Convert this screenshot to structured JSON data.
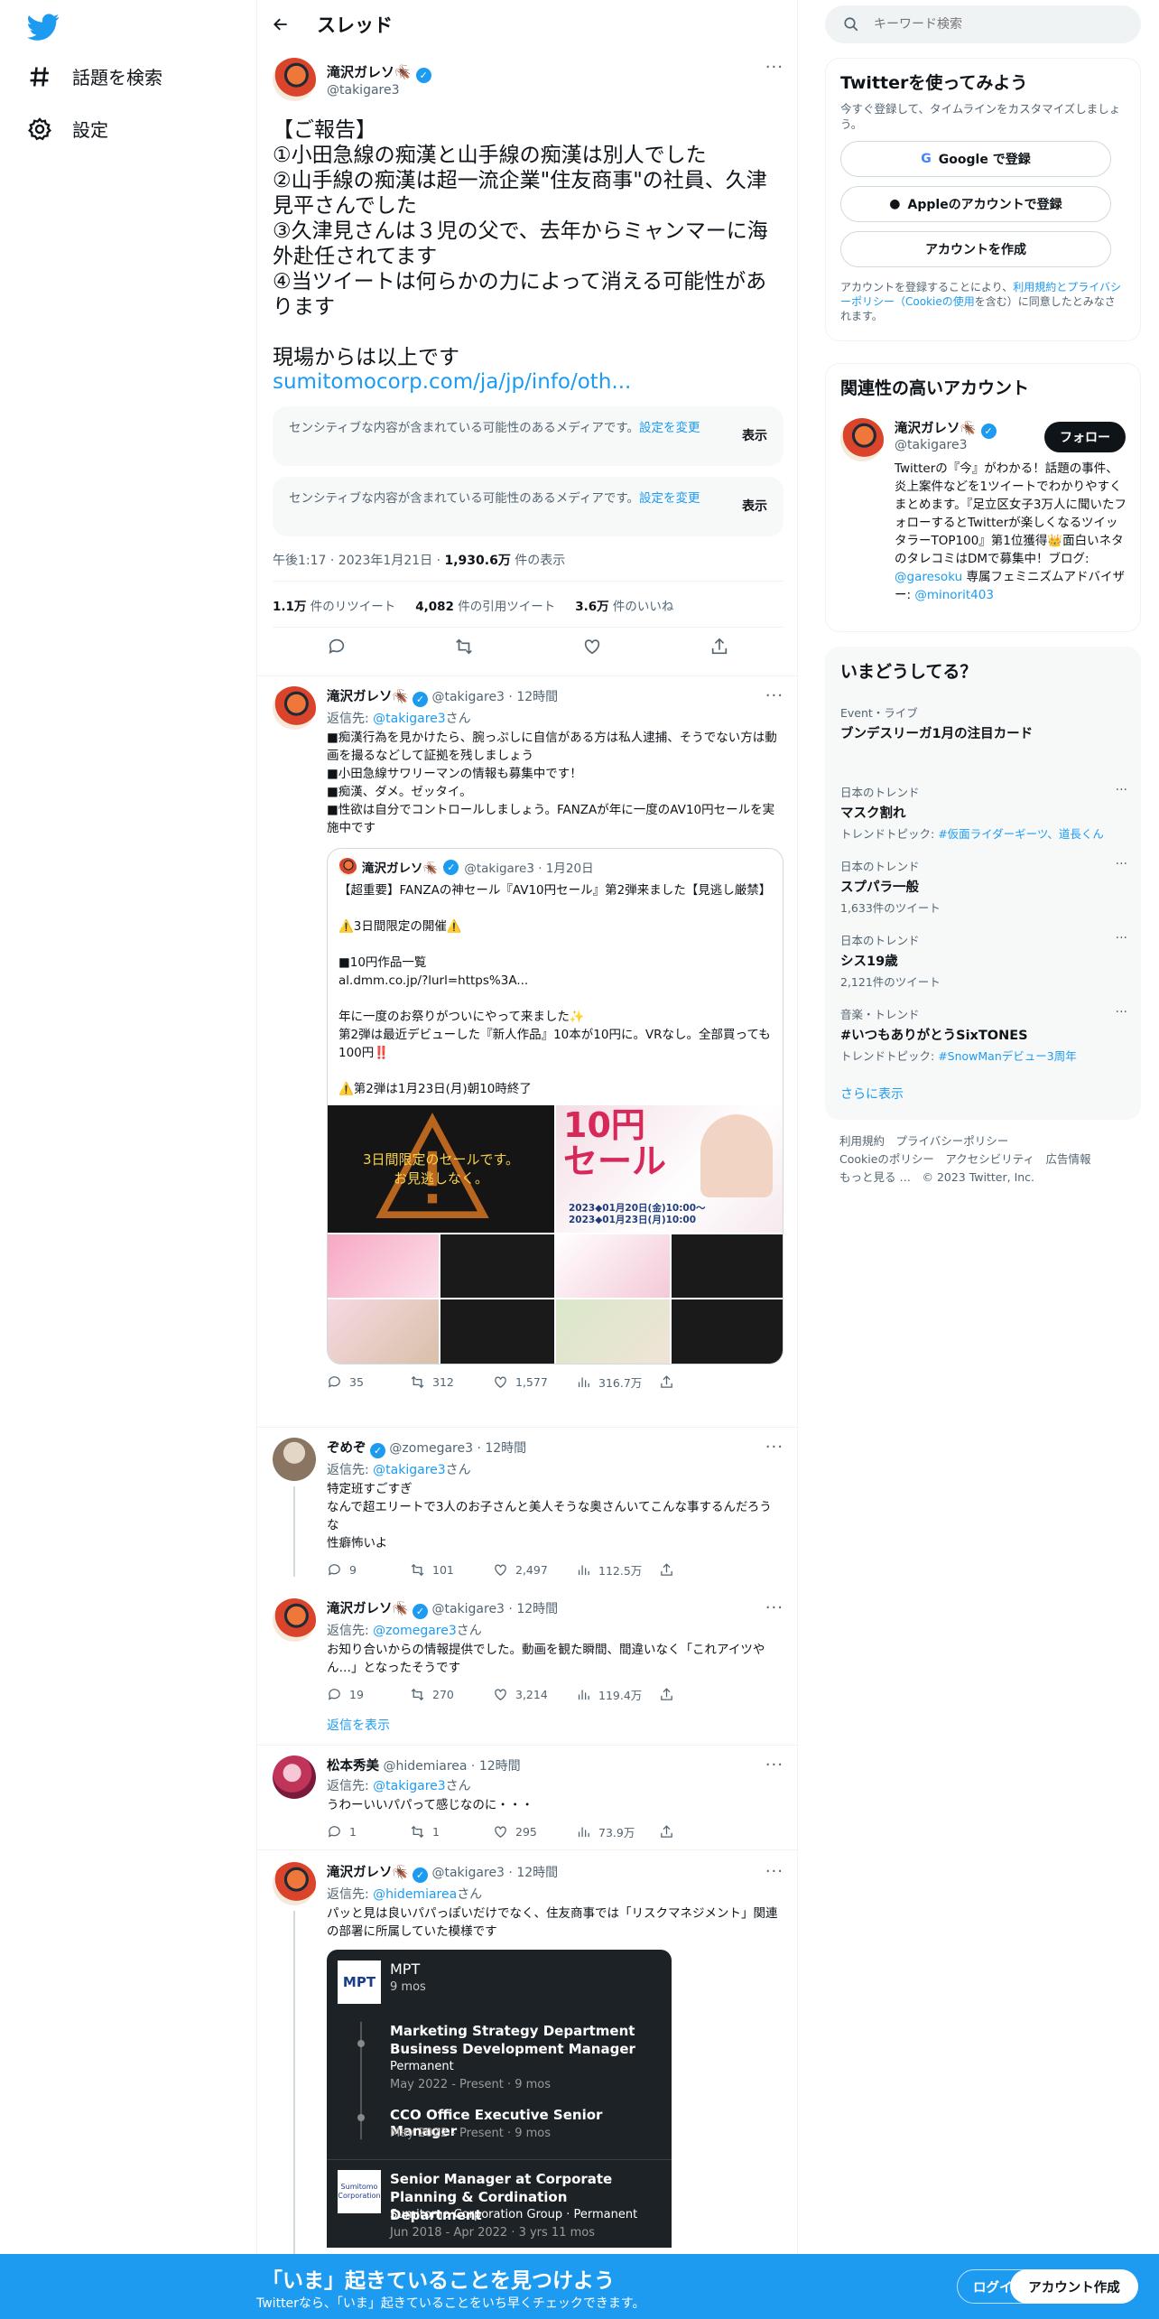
{
  "nav": {
    "items": [
      {
        "label": "話題を検索",
        "icon": "hashtag-icon"
      },
      {
        "label": "設定",
        "icon": "gear-icon"
      }
    ]
  },
  "header": {
    "title": "スレッド"
  },
  "main_tweet": {
    "name": "滝沢ガレソ🪳",
    "handle": "@takigare3",
    "text": "【ご報告】\n①小田急線の痴漢と山手線の痴漢は別人でした\n②山手線の痴漢は超一流企業\"住友商事\"の社員、久津見平さんでした\n③久津見さんは３児の父で、去年からミャンマーに海外赴任されてます\n④当ツイートは何らかの力によって消える可能性があります\n\n現場からは以上です",
    "link": "sumitomocorp.com/ja/jp/info/oth...",
    "sensitive_notice": "センシティブな内容が含まれている可能性のあるメディアです。",
    "sensitive_link": "設定を変更",
    "show_label": "表示",
    "timestamp": "午後1:17 · 2023年1月21日 · ",
    "views": "1,930.6万",
    "views_label": " 件の表示",
    "retweets": "1.1万",
    "retweets_label": " 件のリツイート",
    "quotes": "4,082",
    "quotes_label": " 件の引用ツイート",
    "likes": "3.6万",
    "likes_label": " 件のいいね"
  },
  "replies": [
    {
      "name": "滝沢ガレソ🪳",
      "handle": "@takigare3 · 12時間",
      "to_prefix": "返信先: ",
      "to": "@takigare3",
      "to_suffix": "さん",
      "text": "■痴漢行為を見かけたら、腕っぷしに自信がある方は私人逮捕、そうでない方は動画を撮るなどして証拠を残しましょう\n■小田急線サワリーマンの情報も募集中です！\n■痴漢、ダメ。ゼッタイ。\n■性欲は自分でコントロールしましょう。FANZAが年に一度のAV10円セールを実施中です",
      "quote": {
        "name": "滝沢ガレソ🪳",
        "handle": "@takigare3 · 1月20日",
        "text": "【超重要】FANZAの神セール『AV10円セール』第2弾来ました【見逃し厳禁】\n\n⚠️3日間限定の開催⚠️\n\n■10円作品一覧\nal.dmm.co.jp/?lurl=https%3A...\n\n年に一度のお祭りがついにやって来ました✨\n第2弾は最近デビューした『新人作品』10本が10円に。VRなし。全部買っても100円‼️\n\n⚠️第2弾は1月23日(月)朝10時終了",
        "media_caption": "3日間限定のセールです。\nお見逃しなく。",
        "media_big": "10円\nセール",
        "media_dates": "2023◆01月20日(金)10:00〜\n2023◆01月23日(月)10:00"
      },
      "stats": {
        "replies": "35",
        "retweets": "312",
        "likes": "1,577",
        "views": "316.7万"
      }
    },
    {
      "name": "ぞめぞ",
      "handle": "@zomegare3 · 12時間",
      "to_prefix": "返信先: ",
      "to": "@takigare3",
      "to_suffix": "さん",
      "text": "特定班すごすぎ\nなんで超エリートで3人のお子さんと美人そうな奥さんいてこんな事するんだろうな\n性癖怖いよ",
      "stats": {
        "replies": "9",
        "retweets": "101",
        "likes": "2,497",
        "views": "112.5万"
      }
    },
    {
      "name": "滝沢ガレソ🪳",
      "handle": "@takigare3 · 12時間",
      "to_prefix": "返信先: ",
      "to": "@zomegare3",
      "to_suffix": "さん",
      "text": "お知り合いからの情報提供でした。動画を観た瞬間、間違いなく「これアイツやん…」となったそうです",
      "stats": {
        "replies": "19",
        "retweets": "270",
        "likes": "3,214",
        "views": "119.4万"
      }
    },
    {
      "name": "松本秀美",
      "handle": "@hidemiarea · 12時間",
      "to_prefix": "返信先: ",
      "to": "@takigare3",
      "to_suffix": "さん",
      "text": "うわーいいパパって感じなのに・・・",
      "stats": {
        "replies": "1",
        "retweets": "1",
        "likes": "295",
        "views": "73.9万"
      }
    },
    {
      "name": "滝沢ガレソ🪳",
      "handle": "@takigare3 · 12時間",
      "to_prefix": "返信先: ",
      "to": "@hidemiarea",
      "to_suffix": "さん",
      "text": "パッと見は良いパパっぽいだけでなく、住友商事では「リスクマネジメント」関連の部署に所属していた模様です"
    }
  ],
  "show_replies": "返信を表示",
  "linkedin": {
    "company": "MPT",
    "duration": "9 mos",
    "role1": "Marketing Strategy Department\nBusiness Development Manager",
    "role1_type": "Permanent",
    "role1_dates": "May 2022 - Present · 9 mos",
    "role2": "CCO Office Executive Senior Manager",
    "role2_dates": "May 2022 - Present · 9 mos",
    "role3": "Senior Manager at Corporate Planning & Cordination Department",
    "role3_org": "Sumitomo Corporation Group · Permanent",
    "role3_dates": "Jun 2018 - Apr 2022 · 3 yrs 11 mos",
    "logo1": "MPT",
    "logo2": "Sumitomo\nCorporation"
  },
  "sidebar": {
    "search_placeholder": "キーワード検索",
    "signup": {
      "title": "Twitterを使ってみよう",
      "desc": "今すぐ登録して、タイムラインをカスタマイズしましょう。",
      "google": "Google で登録",
      "apple": "Appleのアカウントで登録",
      "create": "アカウントを作成",
      "terms_prefix": "アカウントを登録することにより、",
      "terms_link": "利用規約とプライバシーポリシー（Cookieの使用",
      "terms_suffix": "を含む）に同意したとみなされます。"
    },
    "related": {
      "title": "関連性の高いアカウント",
      "name": "滝沢ガレソ🪳",
      "handle": "@takigare3",
      "follow": "フォロー",
      "bio": "Twitterの『今』がわかる！話題の事件、炎上案件などを1ツイートでわかりやすくまとめます。『足立区女子3万人に聞いたフォローするとTwitterが楽しくなるツイッタラーTOP100』第1位獲得👑面白いネタのタレコミはDMで募集中！ブログ: ",
      "bio_link1": "@garesoku",
      "bio_mid": " 専属フェミニズムアドバイザー: ",
      "bio_link2": "@minorit403"
    },
    "trends": {
      "title": "いまどうしてる？",
      "items": [
        {
          "cat": "Event・ライブ",
          "name": "ブンデスリーガ1月の注目カード",
          "sub": ""
        },
        {
          "cat": "日本のトレンド",
          "name": "マスク割れ",
          "sub": "トレンドトピック: ",
          "sub_link": "#仮面ライダーギーツ、道長くん"
        },
        {
          "cat": "日本のトレンド",
          "name": "スプパラ一般",
          "sub": "1,633件のツイート",
          "sub_link": ""
        },
        {
          "cat": "日本のトレンド",
          "name": "シス19歳",
          "sub": "2,121件のツイート",
          "sub_link": ""
        },
        {
          "cat": "音楽・トレンド",
          "name": "#いつもありがとうSixTONES",
          "sub": "トレンドトピック: ",
          "sub_link": "#SnowManデビュー3周年"
        }
      ],
      "more": "さらに表示"
    },
    "footer": {
      "line1": "利用規約　プライバシーポリシー",
      "line2": "Cookieのポリシー　アクセシビリティ　広告情報",
      "line3": "もっと見る …　© 2023 Twitter, Inc."
    }
  },
  "banner": {
    "title": "「いま」起きていることを見つけよう",
    "subtitle": "Twitterなら、「いま」起きていることをいち早くチェックできます。",
    "login": "ログイン",
    "signup": "アカウント作成"
  },
  "colors": {
    "accent": "#1d9bf0",
    "text": "#0f1419",
    "muted": "#536471"
  }
}
